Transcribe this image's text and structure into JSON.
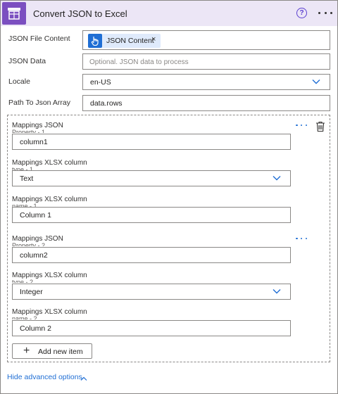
{
  "header": {
    "title": "Convert JSON to Excel",
    "icon": "excel-table-icon",
    "help_icon": "help-circle-icon",
    "help_glyph": "?",
    "more_icon": "more-horizontal-icon",
    "background": "#ece6f6",
    "accent": "#7b4fc0"
  },
  "form": {
    "json_file_content": {
      "label": "JSON File Content",
      "token": {
        "label": "JSON Content",
        "icon": "hand-pointer-icon",
        "remove_glyph": "×",
        "color": "#1f6ed4"
      }
    },
    "json_data": {
      "label": "JSON Data",
      "placeholder": "Optional. JSON data to process",
      "value": ""
    },
    "locale": {
      "label": "Locale",
      "value": "en-US"
    },
    "path_to_json_array": {
      "label": "Path To Json Array",
      "value": "data.rows"
    }
  },
  "mappings": [
    {
      "json_property_label": "Mappings JSON",
      "json_property_sublabel": "Property - 1",
      "json_property_value": "column1",
      "xlsx_type_label": "Mappings XLSX column",
      "xlsx_type_sublabel": "type - 1",
      "xlsx_type_value": "Text",
      "xlsx_name_label": "Mappings XLSX column",
      "xlsx_name_sublabel": "name - 1",
      "xlsx_name_value": "Column 1"
    },
    {
      "json_property_label": "Mappings JSON",
      "json_property_sublabel": "Property - 2",
      "json_property_value": "column2",
      "xlsx_type_label": "Mappings XLSX column",
      "xlsx_type_sublabel": "type - 2",
      "xlsx_type_value": "Integer",
      "xlsx_name_label": "Mappings XLSX column",
      "xlsx_name_sublabel": "name - 2",
      "xlsx_name_value": "Column 2"
    }
  ],
  "actions": {
    "add_new_item": "Add new item",
    "add_glyph": "+",
    "hide_advanced": "Hide advanced options"
  },
  "colors": {
    "link": "#1f6ed4",
    "border": "#8a8886"
  }
}
